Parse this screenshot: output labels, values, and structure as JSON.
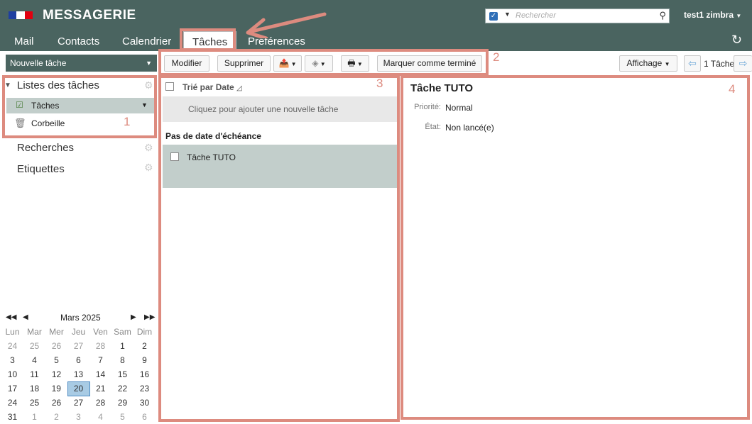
{
  "header": {
    "app_name": "MESSAGERIE",
    "user": "test1 zimbra",
    "search_placeholder": "Rechercher"
  },
  "tabs": [
    {
      "label": "Mail"
    },
    {
      "label": "Contacts"
    },
    {
      "label": "Calendrier"
    },
    {
      "label": "Tâches",
      "active": true
    },
    {
      "label": "Préférences"
    }
  ],
  "toolbar": {
    "new_task": "Nouvelle tâche",
    "edit": "Modifier",
    "delete": "Supprimer",
    "mark_done": "Marquer comme terminé",
    "view": "Affichage",
    "count": "1 Tâche"
  },
  "sidebar": {
    "task_lists_header": "Listes des tâches",
    "items": [
      {
        "label": "Tâches"
      },
      {
        "label": "Corbeille"
      }
    ],
    "searches": "Recherches",
    "tags": "Etiquettes"
  },
  "calendar": {
    "month": "Mars 2025",
    "weekdays": [
      "Lun",
      "Mar",
      "Mer",
      "Jeu",
      "Ven",
      "Sam",
      "Dim"
    ],
    "weeks": [
      [
        "24",
        "25",
        "26",
        "27",
        "28",
        "1",
        "2"
      ],
      [
        "3",
        "4",
        "5",
        "6",
        "7",
        "8",
        "9"
      ],
      [
        "10",
        "11",
        "12",
        "13",
        "14",
        "15",
        "16"
      ],
      [
        "17",
        "18",
        "19",
        "20",
        "21",
        "22",
        "23"
      ],
      [
        "24",
        "25",
        "26",
        "27",
        "28",
        "29",
        "30"
      ],
      [
        "31",
        "1",
        "2",
        "3",
        "4",
        "5",
        "6"
      ]
    ],
    "today": "20"
  },
  "task_list": {
    "sort_label": "Trié par Date",
    "add_hint": "Cliquez pour ajouter une nouvelle tâche",
    "group": "Pas de date d'échéance",
    "tasks": [
      {
        "title": "Tâche TUTO"
      }
    ]
  },
  "detail": {
    "title": "Tâche TUTO",
    "priority_label": "Priorité:",
    "priority": "Normal",
    "status_label": "État:",
    "status": "Non lancé(e)"
  },
  "annotations": [
    "1",
    "2",
    "3",
    "4"
  ],
  "colors": {
    "header": "#4a6460",
    "highlight": "#dd8b7f",
    "selected_row": "#c2cecb"
  }
}
